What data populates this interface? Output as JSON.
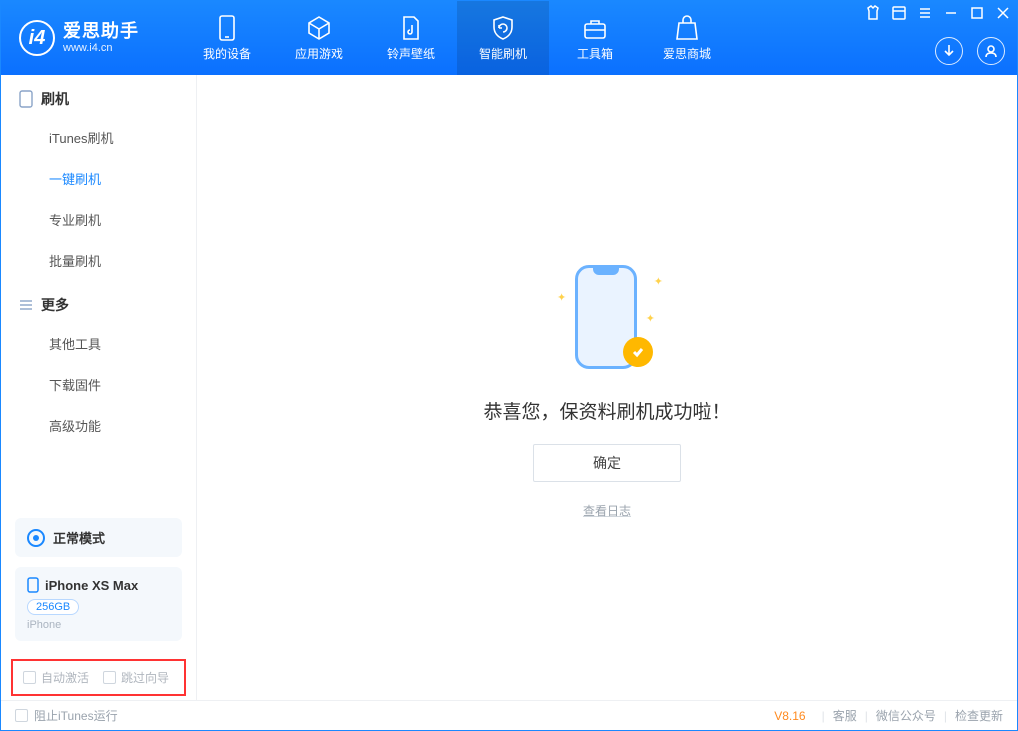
{
  "app": {
    "title": "爱思助手",
    "subtitle": "www.i4.cn"
  },
  "nav": {
    "my_device": "我的设备",
    "apps_games": "应用游戏",
    "ring_wall": "铃声壁纸",
    "smart_flash": "智能刷机",
    "toolbox": "工具箱",
    "store": "爱思商城"
  },
  "sidebar": {
    "flash_hdr": "刷机",
    "itunes_flash": "iTunes刷机",
    "one_key_flash": "一键刷机",
    "pro_flash": "专业刷机",
    "batch_flash": "批量刷机",
    "more_hdr": "更多",
    "other_tools": "其他工具",
    "download_fw": "下载固件",
    "adv_func": "高级功能"
  },
  "device": {
    "mode": "正常模式",
    "name": "iPhone XS Max",
    "capacity": "256GB",
    "type": "iPhone"
  },
  "options": {
    "auto_activate": "自动激活",
    "skip_guide": "跳过向导"
  },
  "main": {
    "success_msg": "恭喜您，保资料刷机成功啦！",
    "ok_btn": "确定",
    "view_log": "查看日志"
  },
  "footer": {
    "block_itunes": "阻止iTunes运行",
    "version": "V8.16",
    "support": "客服",
    "wechat": "微信公众号",
    "check_update": "检查更新"
  }
}
